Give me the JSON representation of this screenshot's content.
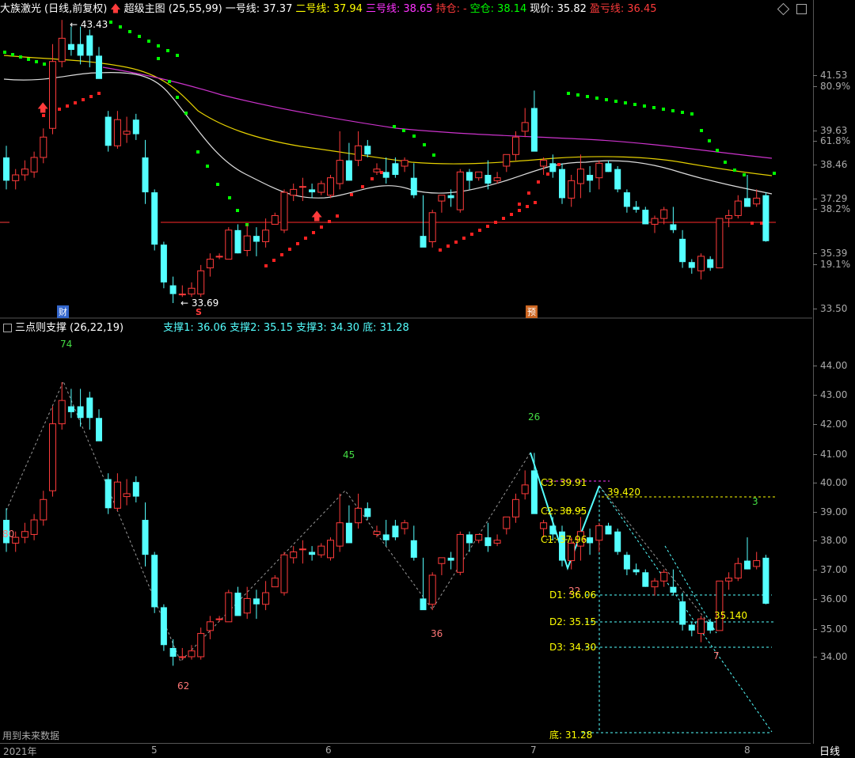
{
  "top": {
    "stock_name": "大族激光",
    "period_label": "(日线,前复权)",
    "indicator_name": "超级主图",
    "indicator_params": "(25,55,99)",
    "line1_label": "一号线:",
    "line1_value": "37.37",
    "line2_label": "二号线:",
    "line2_value": "37.94",
    "line3_label": "三号线:",
    "line3_value": "38.65",
    "hold_label": "持仓:",
    "hold_value": "-",
    "empty_label": "空仓:",
    "empty_value": "38.14",
    "price_label": "现价:",
    "price_value": "35.82",
    "profit_label": "盈亏线:",
    "profit_value": "36.45",
    "peak_label": "43.43",
    "low_label": "33.69",
    "tag_cai": "财",
    "tag_s": "S",
    "tag_yu": "预"
  },
  "bottom": {
    "indicator_name": "三点则支撑",
    "indicator_params": "(26,22,19)",
    "s1": "支撑1: 36.06",
    "s2": "支撑2: 35.15",
    "s3": "支撑3: 34.30",
    "base": "底: 31.28",
    "n74": "74",
    "n80": "80",
    "n62": "62",
    "n45": "45",
    "n36": "36",
    "n26": "26",
    "n22": "22",
    "n3": "3",
    "n7": "7",
    "c3": "C3: 39.91",
    "c2": "C2: 38.95",
    "c1": "C1: 37.96",
    "d1": "D1: 36.06",
    "d2": "D2: 35.15",
    "d3": "D3: 34.30",
    "base_label": "底: 31.28",
    "v39420": "39.420",
    "v35140": "35.140",
    "footnote": "用到未来数据"
  },
  "yaxis_top": [
    "41.53",
    "80.9%",
    "39.63",
    "61.8%",
    "38.46",
    "37.29",
    "38.2%",
    "35.39",
    "19.1%",
    "33.50"
  ],
  "yaxis_bottom": [
    "44.00",
    "43.00",
    "42.00",
    "41.00",
    "40.00",
    "39.00",
    "38.00",
    "37.00",
    "36.00",
    "35.00",
    "34.00"
  ],
  "xaxis": [
    "2021年",
    "5",
    "6",
    "7",
    "8"
  ],
  "period_tab": "日线",
  "colors": {
    "up": "#ff3b3b",
    "down": "#54ffff",
    "yellow": "#ffff00",
    "magenta": "#ff33ff",
    "green": "#00ff00",
    "white": "#dddddd",
    "dash": "#888888"
  },
  "chart_data": {
    "type": "candlestick",
    "x_labels": [
      "2021年",
      "5",
      "6",
      "7",
      "8"
    ],
    "candles_ohlc": [
      [
        38.7,
        39.1,
        37.6,
        37.9
      ],
      [
        37.9,
        38.3,
        37.6,
        38.1
      ],
      [
        38.1,
        38.6,
        37.9,
        38.3
      ],
      [
        38.2,
        38.9,
        38.0,
        38.7
      ],
      [
        38.7,
        39.7,
        38.5,
        39.4
      ],
      [
        39.7,
        42.6,
        39.5,
        42.0
      ],
      [
        42.0,
        43.43,
        41.8,
        42.8
      ],
      [
        42.6,
        43.2,
        42.2,
        42.4
      ],
      [
        42.6,
        43.2,
        41.9,
        42.2
      ],
      [
        42.9,
        43.1,
        41.8,
        42.2
      ],
      [
        42.2,
        42.5,
        41.7,
        41.4
      ],
      [
        40.1,
        40.3,
        38.9,
        39.1
      ],
      [
        39.1,
        40.3,
        39.0,
        40.0
      ],
      [
        39.5,
        40.1,
        39.2,
        39.6
      ],
      [
        40.0,
        40.2,
        39.3,
        39.5
      ],
      [
        38.7,
        39.3,
        37.1,
        37.5
      ],
      [
        37.5,
        37.6,
        35.5,
        35.7
      ],
      [
        35.7,
        35.8,
        34.2,
        34.4
      ],
      [
        34.3,
        34.6,
        33.69,
        34.0
      ],
      [
        34.0,
        34.3,
        33.9,
        34.0
      ],
      [
        34.0,
        34.4,
        33.9,
        34.2
      ],
      [
        34.0,
        35.0,
        33.9,
        34.8
      ],
      [
        34.9,
        35.4,
        34.6,
        35.2
      ],
      [
        35.3,
        35.4,
        35.2,
        35.3
      ],
      [
        35.2,
        36.3,
        35.2,
        36.2
      ],
      [
        36.2,
        36.4,
        35.4,
        35.4
      ],
      [
        35.5,
        36.4,
        35.3,
        36.0
      ],
      [
        36.0,
        36.3,
        35.3,
        35.8
      ],
      [
        35.8,
        36.6,
        35.6,
        36.2
      ],
      [
        36.4,
        36.8,
        36.4,
        36.7
      ],
      [
        36.2,
        37.6,
        36.1,
        37.5
      ],
      [
        37.4,
        37.8,
        37.2,
        37.6
      ],
      [
        37.7,
        38.0,
        37.2,
        37.7
      ],
      [
        37.6,
        37.8,
        37.3,
        37.5
      ],
      [
        37.5,
        37.9,
        37.4,
        37.8
      ],
      [
        37.4,
        38.1,
        37.3,
        38.0
      ],
      [
        37.8,
        39.6,
        37.6,
        38.6
      ],
      [
        38.6,
        39.2,
        37.9,
        37.9
      ],
      [
        38.6,
        39.6,
        38.4,
        39.1
      ],
      [
        39.1,
        39.3,
        38.7,
        38.8
      ],
      [
        38.2,
        38.5,
        38.1,
        38.3
      ],
      [
        38.2,
        38.7,
        37.8,
        38.0
      ],
      [
        38.5,
        38.7,
        38.0,
        38.1
      ],
      [
        38.4,
        38.7,
        38.2,
        38.6
      ],
      [
        38.0,
        38.5,
        37.3,
        37.4
      ],
      [
        36.0,
        37.4,
        35.7,
        35.6
      ],
      [
        35.8,
        36.9,
        35.6,
        36.8
      ],
      [
        37.2,
        37.4,
        36.8,
        37.4
      ],
      [
        37.4,
        37.6,
        37.0,
        37.3
      ],
      [
        36.9,
        38.3,
        36.8,
        38.2
      ],
      [
        38.2,
        38.3,
        37.6,
        37.9
      ],
      [
        38.0,
        38.2,
        37.9,
        38.2
      ],
      [
        38.1,
        38.6,
        37.6,
        37.8
      ],
      [
        37.9,
        38.2,
        37.8,
        38.0
      ],
      [
        38.4,
        38.8,
        38.2,
        38.8
      ],
      [
        38.8,
        39.6,
        38.6,
        39.4
      ],
      [
        39.6,
        40.4,
        39.4,
        39.9
      ],
      [
        40.4,
        41.0,
        39.7,
        38.9
      ],
      [
        38.4,
        38.7,
        38.1,
        38.6
      ],
      [
        38.5,
        38.8,
        38.0,
        38.2
      ],
      [
        38.3,
        38.5,
        37.1,
        37.3
      ],
      [
        37.3,
        38.1,
        37.0,
        37.9
      ],
      [
        37.8,
        38.8,
        37.3,
        38.3
      ],
      [
        38.1,
        38.4,
        37.5,
        37.9
      ],
      [
        38.0,
        38.6,
        37.6,
        38.5
      ],
      [
        38.5,
        38.6,
        38.2,
        38.2
      ],
      [
        38.3,
        38.4,
        37.5,
        37.6
      ],
      [
        37.5,
        37.6,
        36.8,
        37.0
      ],
      [
        37.0,
        37.2,
        36.8,
        36.9
      ],
      [
        36.9,
        37.0,
        36.4,
        36.4
      ],
      [
        36.4,
        36.7,
        36.1,
        36.6
      ],
      [
        36.6,
        37.0,
        36.4,
        36.9
      ],
      [
        36.4,
        37.0,
        36.1,
        36.2
      ],
      [
        35.9,
        36.2,
        34.9,
        35.1
      ],
      [
        35.1,
        35.2,
        34.7,
        34.9
      ],
      [
        34.8,
        35.4,
        34.5,
        35.3
      ],
      [
        35.2,
        35.3,
        34.8,
        34.9
      ],
      [
        34.9,
        36.6,
        34.9,
        36.6
      ],
      [
        36.6,
        36.9,
        36.3,
        36.7
      ],
      [
        36.7,
        37.4,
        36.6,
        37.2
      ],
      [
        37.3,
        38.1,
        37.0,
        37.0
      ],
      [
        37.1,
        37.6,
        37.0,
        37.3
      ],
      [
        37.4,
        37.5,
        35.8,
        35.82
      ]
    ]
  }
}
